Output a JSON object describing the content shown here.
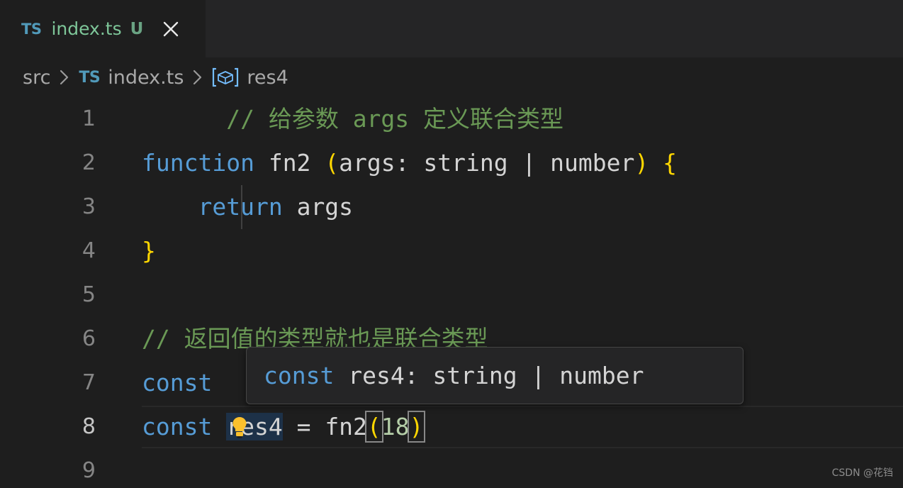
{
  "tab": {
    "file_icon": "TS",
    "label": "index.ts",
    "git_status": "U",
    "close_icon": "close-icon"
  },
  "breadcrumb": {
    "items": [
      {
        "label": "src",
        "icon": ""
      },
      {
        "label": "index.ts",
        "icon": "TS"
      },
      {
        "label": "res4",
        "icon": "[⊕]"
      }
    ],
    "separator": "›"
  },
  "editor": {
    "lines": [
      {
        "no": "1",
        "text": "// 给参数 args 定义联合类型"
      },
      {
        "no": "2",
        "text": "function fn2 (args: string | number) {"
      },
      {
        "no": "3",
        "text": "  return args"
      },
      {
        "no": "4",
        "text": "}"
      },
      {
        "no": "5",
        "text": ""
      },
      {
        "no": "6",
        "text": "// 返回值的类型就也是联合类型"
      },
      {
        "no": "7",
        "text": "const"
      },
      {
        "no": "8",
        "text": "const res4 = fn2(18)"
      },
      {
        "no": "9",
        "text": ""
      }
    ],
    "l1_comment": "// 给参数 args 定义联合类型",
    "l2_kw": "function",
    "l2_name": " fn2 ",
    "l2_open": "(",
    "l2_params": "args: string | number",
    "l2_close": ")",
    "l2_brace": " {",
    "l3_kw": "return",
    "l3_rest": " args",
    "l4_brace": "}",
    "l6_comment": "// 返回值的类型就也是联合类型",
    "l7_kw": "const",
    "l8_kw": "const",
    "l8_space1": " ",
    "l8_sel": "res4",
    "l8_eq": " = ",
    "l8_fn": "fn2",
    "l8_open": "(",
    "l8_num": "18",
    "l8_close": ")",
    "lightbulb_icon": "lightbulb-icon"
  },
  "tooltip": {
    "keyword": "const",
    "rest": " res4: string | number"
  },
  "watermark": {
    "text": "CSDN @花铛"
  },
  "colors": {
    "editor_bg": "#1e1e1e",
    "tabbar_bg": "#252526",
    "comment": "#6a9955",
    "keyword": "#569cd6",
    "function": "#dcdcaa",
    "number": "#b5cea8",
    "bracket": "#ffd700",
    "selection": "#1d3148",
    "symbol_blue": "#75beff",
    "ts_blue": "#519aba",
    "git_green": "#7ec699"
  }
}
